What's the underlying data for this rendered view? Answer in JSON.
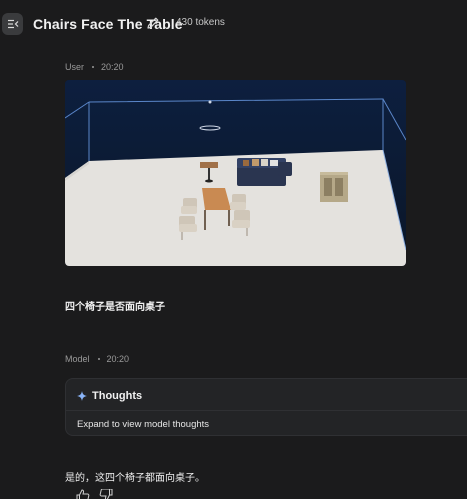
{
  "header": {
    "title": "Chairs Face The Table",
    "token_count": "430 tokens"
  },
  "user_turn": {
    "role": "User",
    "time": "20:20",
    "text": "四个椅子是否面向桌子"
  },
  "model_turn": {
    "role": "Model",
    "time": "20:20",
    "thoughts_title": "Thoughts",
    "thoughts_expand": "Expand to view model thoughts",
    "answer": "是的，这四个椅子都面向桌子。"
  },
  "colors": {
    "background": "#1b1b1c",
    "accent": "#8ab4f8",
    "scene_sky": "#0c1a33",
    "floor": "#e8e6e2"
  },
  "icons": [
    "menu-collapse-icon",
    "pencil-icon",
    "sparkle-icon",
    "thumbs-up-icon",
    "thumbs-down-icon"
  ]
}
